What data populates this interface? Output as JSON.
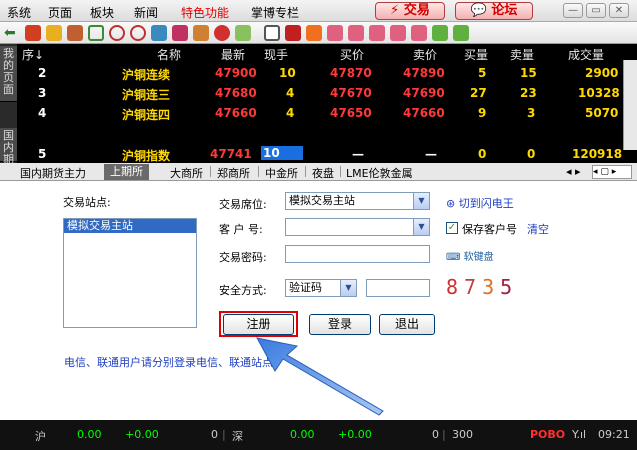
{
  "menubar": {
    "items": [
      "系统",
      "页面",
      "板块",
      "新闻",
      "特色功能",
      "掌博专栏"
    ],
    "trade_label": "交易",
    "forum_label": "论坛"
  },
  "grid": {
    "side_tabs": [
      "我的页面",
      "国内期"
    ],
    "headers": [
      "序↓",
      "名称",
      "最新",
      "现手",
      "买价",
      "卖价",
      "买量",
      "卖量",
      "成交量"
    ],
    "rows": [
      {
        "seq": "2",
        "name": "沪铜连续",
        "last": "47900",
        "vol": "10",
        "bid": "47870",
        "ask": "47890",
        "bidq": "5",
        "askq": "15",
        "total": "2900"
      },
      {
        "seq": "3",
        "name": "沪铜连三",
        "last": "47680",
        "vol": "4",
        "bid": "47670",
        "ask": "47690",
        "bidq": "27",
        "askq": "23",
        "total": "10328"
      },
      {
        "seq": "4",
        "name": "沪铜连四",
        "last": "47660",
        "vol": "4",
        "bid": "47650",
        "ask": "47660",
        "bidq": "9",
        "askq": "3",
        "total": "5070"
      },
      {
        "seq": "5",
        "name": "沪铜指数",
        "last": "47741",
        "vol": "10",
        "bid": "—",
        "ask": "—",
        "bidq": "0",
        "askq": "0",
        "total": "120918"
      }
    ]
  },
  "market_tabs": [
    "国内期货主力",
    "上期所",
    "大商所",
    "郑商所",
    "中金所",
    "夜盘",
    "LME伦敦金属"
  ],
  "login": {
    "station_label": "交易站点:",
    "station_selected": "模拟交易主站",
    "seat_label": "交易席位:",
    "seat_value": "模拟交易主站",
    "switch_link": "切到闪电王",
    "account_label": "客 户 号:",
    "save_account_label": "保存客户号",
    "clear_link": "清空",
    "password_label": "交易密码:",
    "soft_keyboard": "软键盘",
    "security_label": "安全方式:",
    "security_value": "验证码",
    "captcha": "8735",
    "register_btn": "注册",
    "login_btn": "登录",
    "exit_btn": "退出",
    "notice": "电信、联通用户请分别登录电信、联通站点。"
  },
  "status": {
    "sh_label": "沪",
    "sh_value": "0.00",
    "sh_change": "+0.00",
    "mid_value": "0",
    "sz_label": "深",
    "sz_value": "0.00",
    "sz_change": "+0.00",
    "sz_vol": "0",
    "num": "300",
    "pobo": "POBO",
    "signal": "Y.ıl",
    "time": "09:21"
  }
}
